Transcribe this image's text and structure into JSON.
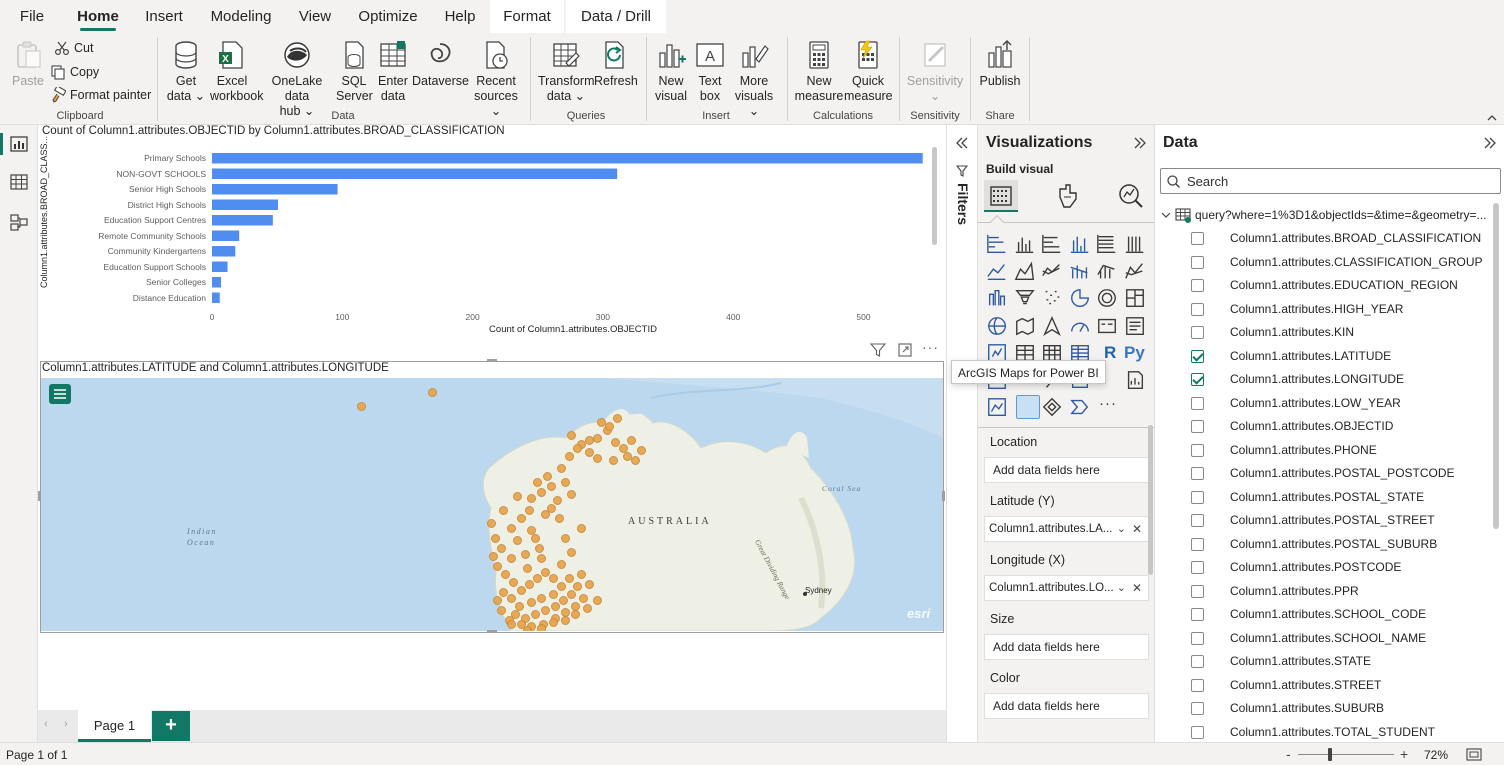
{
  "menu": {
    "file": "File",
    "home": "Home",
    "insert": "Insert",
    "modeling": "Modeling",
    "view": "View",
    "optimize": "Optimize",
    "help": "Help",
    "format": "Format",
    "data_drill": "Data / Drill"
  },
  "ribbon": {
    "clipboard": {
      "paste": "Paste",
      "cut": "Cut",
      "copy": "Copy",
      "format_painter": "Format painter",
      "group": "Clipboard"
    },
    "data": {
      "get_data": [
        "Get",
        "data"
      ],
      "excel": [
        "Excel",
        "workbook"
      ],
      "onelake": [
        "OneLake data",
        "hub"
      ],
      "sql": [
        "SQL",
        "Server"
      ],
      "enter": [
        "Enter",
        "data"
      ],
      "dataverse": "Dataverse",
      "recent": [
        "Recent",
        "sources"
      ],
      "group": "Data"
    },
    "queries": {
      "transform": [
        "Transform",
        "data"
      ],
      "refresh": "Refresh",
      "group": "Queries"
    },
    "insert": {
      "new_visual": [
        "New",
        "visual"
      ],
      "text_box": [
        "Text",
        "box"
      ],
      "more_visuals": [
        "More",
        "visuals"
      ],
      "group": "Insert"
    },
    "calculations": {
      "new_measure": [
        "New",
        "measure"
      ],
      "quick_measure": [
        "Quick",
        "measure"
      ],
      "group": "Calculations"
    },
    "sensitivity": {
      "label": "Sensitivity",
      "group": "Sensitivity"
    },
    "share": {
      "publish": "Publish",
      "group": "Share"
    }
  },
  "bar_chart": {
    "title": "Count of Column1.attributes.OBJECTID by Column1.attributes.BROAD_CLASSIFICATION",
    "ylabel": "Column1.attributes.BROAD_CLASS...",
    "xlabel": "Count of Column1.attributes.OBJECTID",
    "xticks": [
      "0",
      "100",
      "200",
      "300",
      "400",
      "500"
    ]
  },
  "chart_data": {
    "type": "bar",
    "orientation": "horizontal",
    "categories": [
      "Primary Schools",
      "NON-GOVT SCHOOLS",
      "Senior High Schools",
      "District High Schools",
      "Education Support Centres",
      "Remote Community Schools",
      "Community Kindergartens",
      "Education Support Schools",
      "Senior Colleges",
      "Distance Education"
    ],
    "values": [
      549,
      313,
      97,
      51,
      47,
      21,
      18,
      12,
      7,
      6
    ],
    "xlim": [
      0,
      550
    ],
    "title": "Count of Column1.attributes.OBJECTID by Column1.attributes.BROAD_CLASSIFICATION",
    "xlabel": "Count of Column1.attributes.OBJECTID",
    "ylabel": "Column1.attributes.BROAD_CLASS...",
    "color": "#4f8ef0",
    "grid": false
  },
  "map": {
    "title": "Column1.attributes.LATITUDE and Column1.attributes.LONGITUDE",
    "labels": {
      "australia": "AUSTRALIA",
      "indian": "Indian",
      "ocean": "Ocean",
      "coral_sea": "Coral Sea",
      "range": "Great Dividing Range",
      "sydney": "Sydney",
      "esri": "esri"
    }
  },
  "tooltip": "ArcGIS Maps for Power BI",
  "filters_label": "Filters",
  "visualizations": {
    "title": "Visualizations",
    "build_visual": "Build visual",
    "r_label": "R",
    "py_label": "Py",
    "more": "···",
    "wells": [
      {
        "title": "Location",
        "value": "Add data fields here",
        "filled": false
      },
      {
        "title": "Latitude (Y)",
        "value": "Column1.attributes.LA...",
        "filled": true
      },
      {
        "title": "Longitude (X)",
        "value": "Column1.attributes.LO...",
        "filled": true
      },
      {
        "title": "Size",
        "value": "Add data fields here",
        "filled": false
      },
      {
        "title": "Color",
        "value": "Add data fields here",
        "filled": false
      }
    ]
  },
  "data_pane": {
    "title": "Data",
    "search_placeholder": "Search",
    "table_name": "query?where=1%3D1&objectIds=&time=&geometry=...",
    "fields": [
      {
        "name": "Column1.attributes.BROAD_CLASSIFICATION",
        "checked": false
      },
      {
        "name": "Column1.attributes.CLASSIFICATION_GROUP",
        "checked": false
      },
      {
        "name": "Column1.attributes.EDUCATION_REGION",
        "checked": false
      },
      {
        "name": "Column1.attributes.HIGH_YEAR",
        "checked": false
      },
      {
        "name": "Column1.attributes.KIN",
        "checked": false
      },
      {
        "name": "Column1.attributes.LATITUDE",
        "checked": true
      },
      {
        "name": "Column1.attributes.LONGITUDE",
        "checked": true
      },
      {
        "name": "Column1.attributes.LOW_YEAR",
        "checked": false
      },
      {
        "name": "Column1.attributes.OBJECTID",
        "checked": false
      },
      {
        "name": "Column1.attributes.PHONE",
        "checked": false
      },
      {
        "name": "Column1.attributes.POSTAL_POSTCODE",
        "checked": false
      },
      {
        "name": "Column1.attributes.POSTAL_STATE",
        "checked": false
      },
      {
        "name": "Column1.attributes.POSTAL_STREET",
        "checked": false
      },
      {
        "name": "Column1.attributes.POSTAL_SUBURB",
        "checked": false
      },
      {
        "name": "Column1.attributes.POSTCODE",
        "checked": false
      },
      {
        "name": "Column1.attributes.PPR",
        "checked": false
      },
      {
        "name": "Column1.attributes.SCHOOL_CODE",
        "checked": false
      },
      {
        "name": "Column1.attributes.SCHOOL_NAME",
        "checked": false
      },
      {
        "name": "Column1.attributes.STATE",
        "checked": false
      },
      {
        "name": "Column1.attributes.STREET",
        "checked": false
      },
      {
        "name": "Column1.attributes.SUBURB",
        "checked": false
      },
      {
        "name": "Column1.attributes.TOTAL_STUDENT",
        "checked": false
      }
    ]
  },
  "pages": {
    "tab": "Page 1",
    "add": "+"
  },
  "status": {
    "page": "Page 1 of 1",
    "zoom": "72%",
    "minus": "-",
    "plus": "+"
  },
  "colors": {
    "accent": "#117865",
    "bar": "#4f8ef0",
    "dot": "#e8a44a",
    "ocean": "#b9d6ec",
    "land": "#eef0e6"
  }
}
